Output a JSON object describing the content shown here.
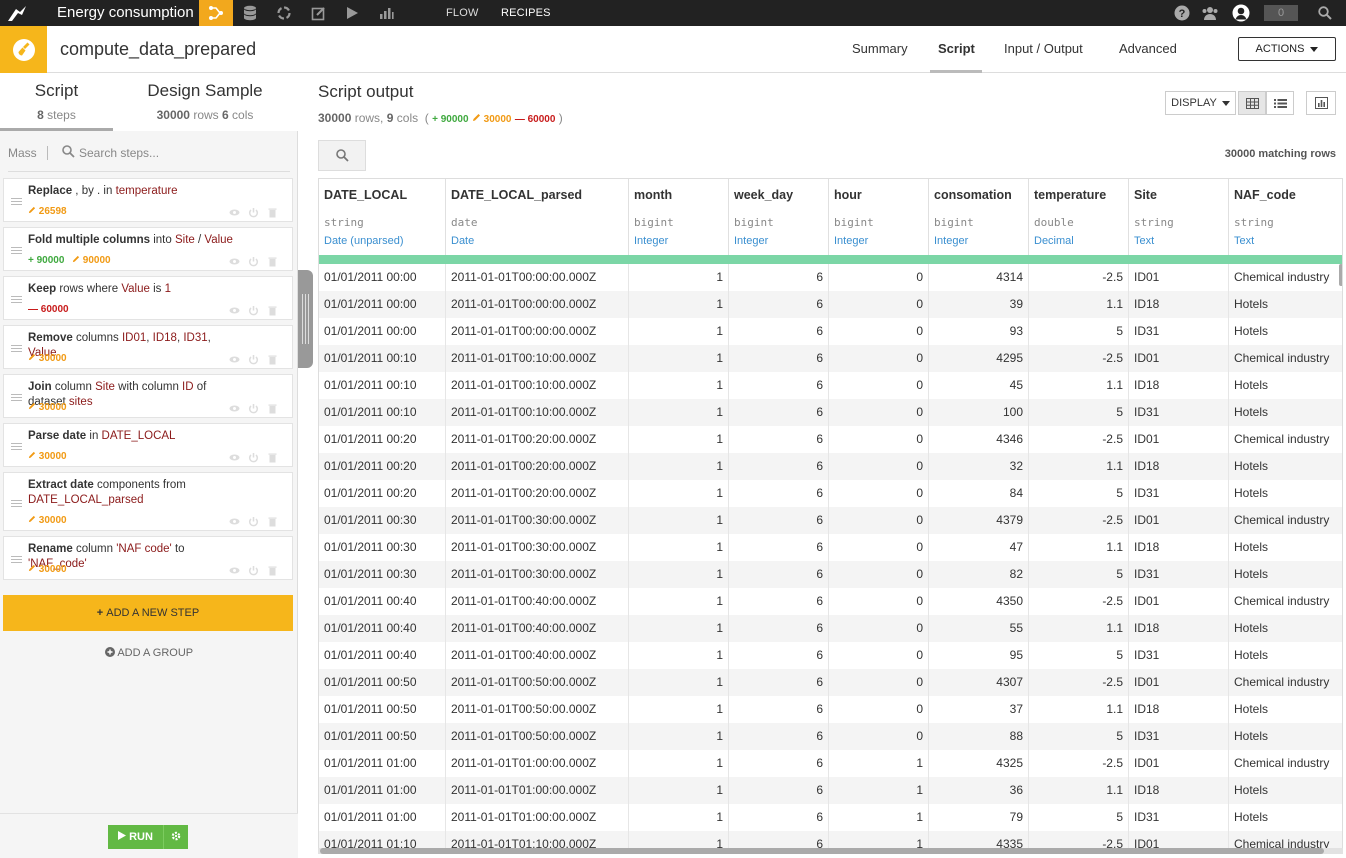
{
  "topnav": {
    "project_name": "Energy consumption",
    "flow_label": "FLOW",
    "recipes_label": "RECIPES",
    "notifications_count": "0"
  },
  "header": {
    "recipe_name": "compute_data_prepared",
    "tabs": [
      "Summary",
      "Script",
      "Input / Output",
      "Advanced"
    ],
    "selected_tab": "Script",
    "actions_label": "ACTIONS"
  },
  "left": {
    "tab_script": {
      "title": "Script",
      "count": "8",
      "unit": "steps"
    },
    "tab_design": {
      "title": "Design Sample",
      "rows": "30000",
      "rows_unit": "rows",
      "cols": "6",
      "cols_unit": "cols"
    },
    "mass_label": "Mass",
    "search_placeholder": "Search steps...",
    "steps": [
      {
        "parts": [
          [
            "b",
            "Replace"
          ],
          [
            "t",
            " , by . in "
          ],
          [
            "v",
            "temperature"
          ]
        ],
        "count": "26598",
        "kind": "orange"
      },
      {
        "parts": [
          [
            "b",
            "Fold multiple columns"
          ],
          [
            "t",
            " into "
          ],
          [
            "v",
            "Site"
          ],
          [
            "t",
            " / "
          ],
          [
            "v",
            "Value"
          ]
        ],
        "counts": [
          [
            "green",
            "90000"
          ],
          [
            "orange",
            "90000"
          ]
        ]
      },
      {
        "parts": [
          [
            "b",
            "Keep"
          ],
          [
            "t",
            " rows where "
          ],
          [
            "v",
            "Value"
          ],
          [
            "t",
            " is "
          ],
          [
            "v",
            "1"
          ]
        ],
        "count": "60000",
        "kind": "red"
      },
      {
        "parts": [
          [
            "b",
            "Remove"
          ],
          [
            "t",
            " columns "
          ],
          [
            "v",
            "ID01"
          ],
          [
            "t",
            ", "
          ],
          [
            "v",
            "ID18"
          ],
          [
            "t",
            ", "
          ],
          [
            "v",
            "ID31"
          ],
          [
            "t",
            ", "
          ],
          [
            "v",
            "Value"
          ]
        ],
        "count": "30000",
        "kind": "orange"
      },
      {
        "parts": [
          [
            "b",
            "Join"
          ],
          [
            "t",
            " column "
          ],
          [
            "v",
            "Site"
          ],
          [
            "t",
            " with column "
          ],
          [
            "v",
            "ID"
          ],
          [
            "t",
            " of dataset "
          ],
          [
            "v",
            "sites"
          ]
        ],
        "count": "30000",
        "kind": "orange"
      },
      {
        "parts": [
          [
            "b",
            "Parse date"
          ],
          [
            "t",
            " in "
          ],
          [
            "v",
            "DATE_LOCAL"
          ]
        ],
        "count": "30000",
        "kind": "orange"
      },
      {
        "parts": [
          [
            "b",
            "Extract date"
          ],
          [
            "t",
            " components from "
          ],
          [
            "v",
            "DATE_LOCAL_parsed"
          ]
        ],
        "count": "30000",
        "kind": "orange"
      },
      {
        "parts": [
          [
            "b",
            "Rename"
          ],
          [
            "t",
            " column "
          ],
          [
            "v",
            "'NAF code'"
          ],
          [
            "t",
            " to "
          ],
          [
            "v",
            "'NAF_code'"
          ]
        ],
        "count": "30000",
        "kind": "orange"
      }
    ],
    "add_step_label": "ADD A NEW STEP",
    "add_group_label": "ADD A GROUP",
    "run_label": "RUN"
  },
  "right": {
    "title": "Script output",
    "rows": "30000",
    "rows_unit": "rows,",
    "cols": "9",
    "cols_unit": "cols",
    "added": "90000",
    "modified": "30000",
    "removed": "60000",
    "display_label": "DISPLAY",
    "matching_rows": "30000 matching rows"
  },
  "table": {
    "columns": [
      {
        "name": "DATE_LOCAL",
        "storage": "string",
        "meaning": "Date (unparsed)",
        "numeric": false
      },
      {
        "name": "DATE_LOCAL_parsed",
        "storage": "date",
        "meaning": "Date",
        "numeric": false
      },
      {
        "name": "month",
        "storage": "bigint",
        "meaning": "Integer",
        "numeric": true
      },
      {
        "name": "week_day",
        "storage": "bigint",
        "meaning": "Integer",
        "numeric": true
      },
      {
        "name": "hour",
        "storage": "bigint",
        "meaning": "Integer",
        "numeric": true
      },
      {
        "name": "consomation",
        "storage": "bigint",
        "meaning": "Integer",
        "numeric": true
      },
      {
        "name": "temperature",
        "storage": "double",
        "meaning": "Decimal",
        "numeric": true
      },
      {
        "name": "Site",
        "storage": "string",
        "meaning": "Text",
        "numeric": false
      },
      {
        "name": "NAF_code",
        "storage": "string",
        "meaning": "Text",
        "numeric": false
      }
    ],
    "rows": [
      [
        "01/01/2011 00:00",
        "2011-01-01T00:00:00.000Z",
        "1",
        "6",
        "0",
        "4314",
        "-2.5",
        "ID01",
        "Chemical industry"
      ],
      [
        "01/01/2011 00:00",
        "2011-01-01T00:00:00.000Z",
        "1",
        "6",
        "0",
        "39",
        "1.1",
        "ID18",
        "Hotels"
      ],
      [
        "01/01/2011 00:00",
        "2011-01-01T00:00:00.000Z",
        "1",
        "6",
        "0",
        "93",
        "5",
        "ID31",
        "Hotels"
      ],
      [
        "01/01/2011 00:10",
        "2011-01-01T00:10:00.000Z",
        "1",
        "6",
        "0",
        "4295",
        "-2.5",
        "ID01",
        "Chemical industry"
      ],
      [
        "01/01/2011 00:10",
        "2011-01-01T00:10:00.000Z",
        "1",
        "6",
        "0",
        "45",
        "1.1",
        "ID18",
        "Hotels"
      ],
      [
        "01/01/2011 00:10",
        "2011-01-01T00:10:00.000Z",
        "1",
        "6",
        "0",
        "100",
        "5",
        "ID31",
        "Hotels"
      ],
      [
        "01/01/2011 00:20",
        "2011-01-01T00:20:00.000Z",
        "1",
        "6",
        "0",
        "4346",
        "-2.5",
        "ID01",
        "Chemical industry"
      ],
      [
        "01/01/2011 00:20",
        "2011-01-01T00:20:00.000Z",
        "1",
        "6",
        "0",
        "32",
        "1.1",
        "ID18",
        "Hotels"
      ],
      [
        "01/01/2011 00:20",
        "2011-01-01T00:20:00.000Z",
        "1",
        "6",
        "0",
        "84",
        "5",
        "ID31",
        "Hotels"
      ],
      [
        "01/01/2011 00:30",
        "2011-01-01T00:30:00.000Z",
        "1",
        "6",
        "0",
        "4379",
        "-2.5",
        "ID01",
        "Chemical industry"
      ],
      [
        "01/01/2011 00:30",
        "2011-01-01T00:30:00.000Z",
        "1",
        "6",
        "0",
        "47",
        "1.1",
        "ID18",
        "Hotels"
      ],
      [
        "01/01/2011 00:30",
        "2011-01-01T00:30:00.000Z",
        "1",
        "6",
        "0",
        "82",
        "5",
        "ID31",
        "Hotels"
      ],
      [
        "01/01/2011 00:40",
        "2011-01-01T00:40:00.000Z",
        "1",
        "6",
        "0",
        "4350",
        "-2.5",
        "ID01",
        "Chemical industry"
      ],
      [
        "01/01/2011 00:40",
        "2011-01-01T00:40:00.000Z",
        "1",
        "6",
        "0",
        "55",
        "1.1",
        "ID18",
        "Hotels"
      ],
      [
        "01/01/2011 00:40",
        "2011-01-01T00:40:00.000Z",
        "1",
        "6",
        "0",
        "95",
        "5",
        "ID31",
        "Hotels"
      ],
      [
        "01/01/2011 00:50",
        "2011-01-01T00:50:00.000Z",
        "1",
        "6",
        "0",
        "4307",
        "-2.5",
        "ID01",
        "Chemical industry"
      ],
      [
        "01/01/2011 00:50",
        "2011-01-01T00:50:00.000Z",
        "1",
        "6",
        "0",
        "37",
        "1.1",
        "ID18",
        "Hotels"
      ],
      [
        "01/01/2011 00:50",
        "2011-01-01T00:50:00.000Z",
        "1",
        "6",
        "0",
        "88",
        "5",
        "ID31",
        "Hotels"
      ],
      [
        "01/01/2011 01:00",
        "2011-01-01T01:00:00.000Z",
        "1",
        "6",
        "1",
        "4325",
        "-2.5",
        "ID01",
        "Chemical industry"
      ],
      [
        "01/01/2011 01:00",
        "2011-01-01T01:00:00.000Z",
        "1",
        "6",
        "1",
        "36",
        "1.1",
        "ID18",
        "Hotels"
      ],
      [
        "01/01/2011 01:00",
        "2011-01-01T01:00:00.000Z",
        "1",
        "6",
        "1",
        "79",
        "5",
        "ID31",
        "Hotels"
      ],
      [
        "01/01/2011 01:10",
        "2011-01-01T01:10:00.000Z",
        "1",
        "6",
        "1",
        "4335",
        "-2.5",
        "ID01",
        "Chemical industry"
      ]
    ]
  },
  "colors": {
    "accent": "#f6b61b",
    "active_nav": "#f2a81d",
    "added": "#3fa93f",
    "modified": "#f19a14",
    "removed": "#c81c1c",
    "value_text": "#8b1a1a",
    "meaning_text": "#3a8fd0",
    "valid_bar": "#7bd6a6",
    "run_button": "#62b944"
  }
}
